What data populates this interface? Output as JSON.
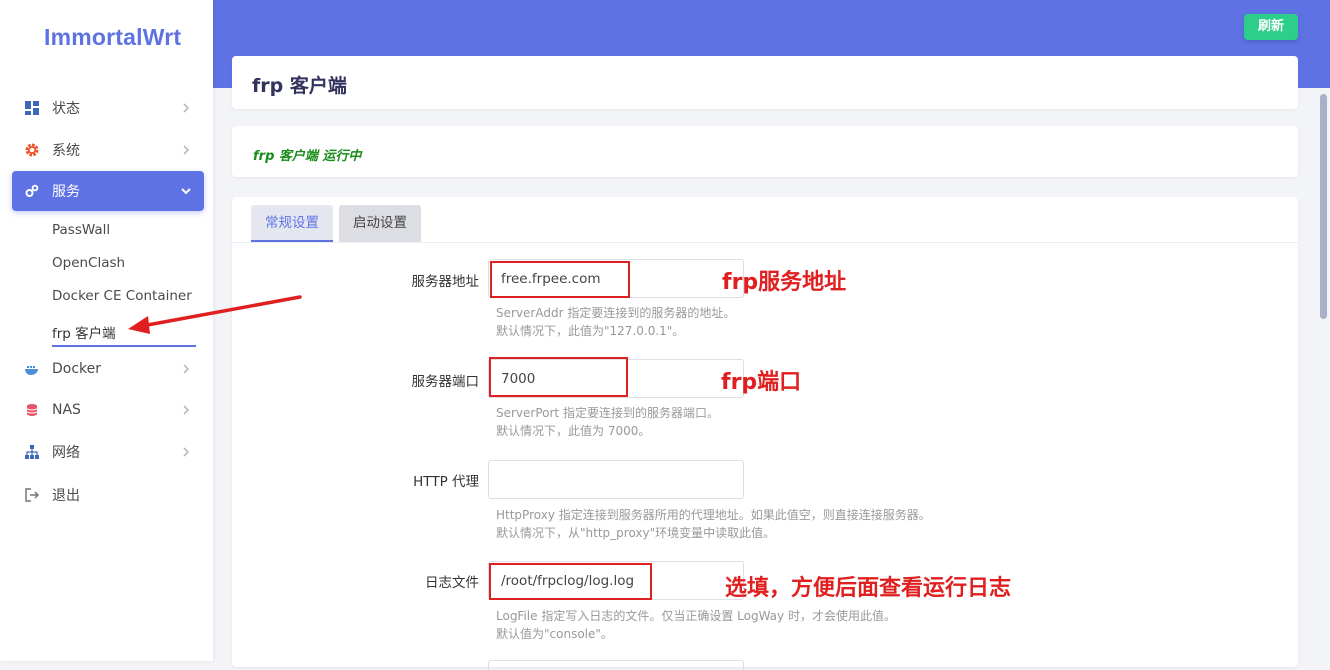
{
  "brand": "ImmortalWrt",
  "header": {
    "refresh_label": "刷新"
  },
  "sidebar": {
    "items": [
      {
        "label": "状态"
      },
      {
        "label": "系统"
      },
      {
        "label": "服务"
      },
      {
        "label": "Docker"
      },
      {
        "label": "NAS"
      },
      {
        "label": "网络"
      },
      {
        "label": "退出"
      }
    ],
    "sub_items": [
      {
        "label": "PassWall"
      },
      {
        "label": "OpenClash"
      },
      {
        "label": "Docker CE Container"
      },
      {
        "label": "frp 客户端"
      }
    ]
  },
  "page": {
    "title": "frp 客户端",
    "status": "frp 客户端 运行中",
    "tabs": [
      {
        "label": "常规设置"
      },
      {
        "label": "启动设置"
      }
    ]
  },
  "form": {
    "server_addr": {
      "label": "服务器地址",
      "value": "free.frpee.com",
      "help1": "ServerAddr 指定要连接到的服务器的地址。",
      "help2": "默认情况下，此值为\"127.0.0.1\"。"
    },
    "server_port": {
      "label": "服务器端口",
      "value": "7000",
      "help1": "ServerPort 指定要连接到的服务器端口。",
      "help2": "默认情况下，此值为 7000。"
    },
    "http_proxy": {
      "label": "HTTP 代理",
      "value": "",
      "help1": "HttpProxy 指定连接到服务器所用的代理地址。如果此值空，则直接连接服务器。",
      "help2": "默认情况下，从\"http_proxy\"环境变量中读取此值。"
    },
    "log_file": {
      "label": "日志文件",
      "value": "/root/frpclog/log.log",
      "help1": "LogFile 指定写入日志的文件。仅当正确设置 LogWay 时，才会使用此值。",
      "help2": "默认值为\"console\"。"
    }
  },
  "annotations": {
    "server_addr": "frp服务地址",
    "server_port": "frp端口",
    "log_file": "选填，方便后面查看运行日志"
  },
  "colors": {
    "accent": "#5e72e4",
    "success": "#2dce89",
    "annotation": "#e02020"
  }
}
